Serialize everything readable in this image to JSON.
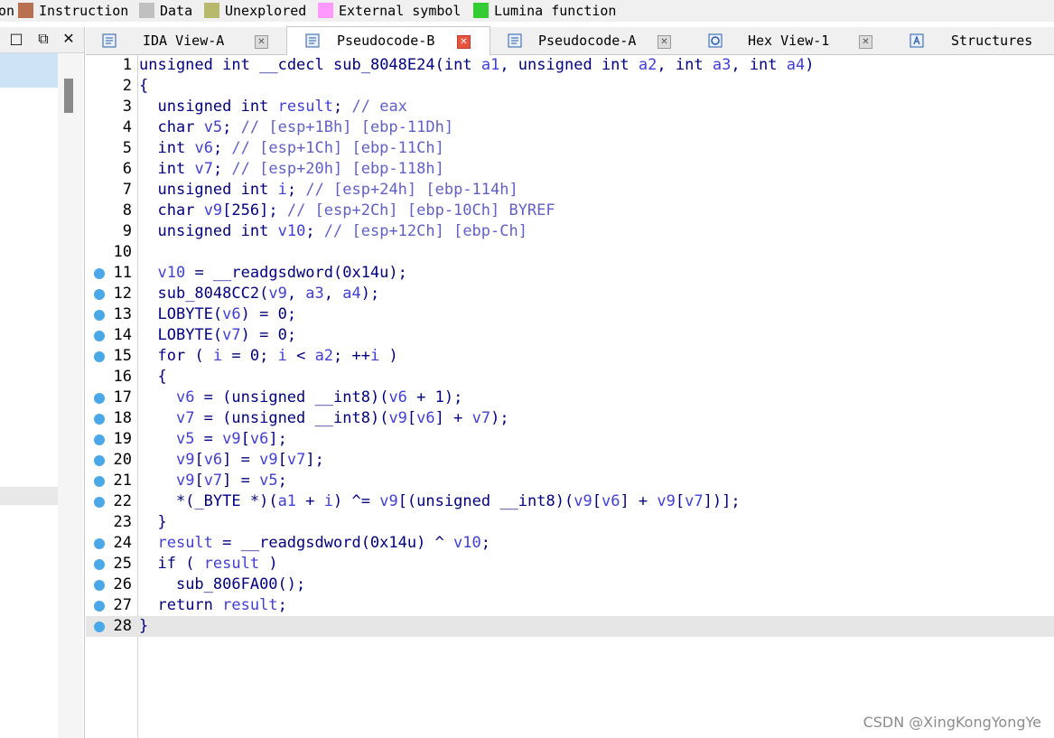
{
  "legend": {
    "items": [
      {
        "label": "on",
        "color": null
      },
      {
        "label": "Instruction",
        "color": "#b97050"
      },
      {
        "label": "Data",
        "color": "#c0c0c0"
      },
      {
        "label": "Unexplored",
        "color": "#b9b96b"
      },
      {
        "label": "External symbol",
        "color": "#ff99ff"
      },
      {
        "label": "Lumina function",
        "color": "#33cc33"
      }
    ]
  },
  "left_panel": {
    "buttons": [
      "□",
      "⧉",
      "✕"
    ]
  },
  "tabs": [
    {
      "label": "IDA View-A",
      "icon": "disassembly-icon",
      "closable": true,
      "active": false
    },
    {
      "label": "Pseudocode-B",
      "icon": "pseudocode-icon",
      "closable": true,
      "active": true
    },
    {
      "label": "Pseudocode-A",
      "icon": "pseudocode-icon",
      "closable": true,
      "active": false
    },
    {
      "label": "Hex View-1",
      "icon": "hex-view-icon",
      "closable": true,
      "active": false
    },
    {
      "label": "Structures",
      "icon": "structures-icon",
      "closable": false,
      "active": false
    }
  ],
  "colors": {
    "keyword": "#000080",
    "variable": "#3f3fd8",
    "comment": "#6060c8",
    "number": "#000080",
    "breakpoint": "#4aa8e8"
  },
  "code": {
    "current_line": 28,
    "lines": [
      {
        "num": "1",
        "bp": false,
        "text": "unsigned int __cdecl sub_8048E24(int a1, unsigned int a2, int a3, int a4)"
      },
      {
        "num": "2",
        "bp": false,
        "text": "{"
      },
      {
        "num": "3",
        "bp": false,
        "text": "  unsigned int result; // eax"
      },
      {
        "num": "4",
        "bp": false,
        "text": "  char v5; // [esp+1Bh] [ebp-11Dh]"
      },
      {
        "num": "5",
        "bp": false,
        "text": "  int v6; // [esp+1Ch] [ebp-11Ch]"
      },
      {
        "num": "6",
        "bp": false,
        "text": "  int v7; // [esp+20h] [ebp-118h]"
      },
      {
        "num": "7",
        "bp": false,
        "text": "  unsigned int i; // [esp+24h] [ebp-114h]"
      },
      {
        "num": "8",
        "bp": false,
        "text": "  char v9[256]; // [esp+2Ch] [ebp-10Ch] BYREF"
      },
      {
        "num": "9",
        "bp": false,
        "text": "  unsigned int v10; // [esp+12Ch] [ebp-Ch]"
      },
      {
        "num": "10",
        "bp": false,
        "text": ""
      },
      {
        "num": "11",
        "bp": true,
        "text": "  v10 = __readgsdword(0x14u);"
      },
      {
        "num": "12",
        "bp": true,
        "text": "  sub_8048CC2(v9, a3, a4);"
      },
      {
        "num": "13",
        "bp": true,
        "text": "  LOBYTE(v6) = 0;"
      },
      {
        "num": "14",
        "bp": true,
        "text": "  LOBYTE(v7) = 0;"
      },
      {
        "num": "15",
        "bp": true,
        "text": "  for ( i = 0; i < a2; ++i )"
      },
      {
        "num": "16",
        "bp": false,
        "text": "  {"
      },
      {
        "num": "17",
        "bp": true,
        "text": "    v6 = (unsigned __int8)(v6 + 1);"
      },
      {
        "num": "18",
        "bp": true,
        "text": "    v7 = (unsigned __int8)(v9[v6] + v7);"
      },
      {
        "num": "19",
        "bp": true,
        "text": "    v5 = v9[v6];"
      },
      {
        "num": "20",
        "bp": true,
        "text": "    v9[v6] = v9[v7];"
      },
      {
        "num": "21",
        "bp": true,
        "text": "    v9[v7] = v5;"
      },
      {
        "num": "22",
        "bp": true,
        "text": "    *(_BYTE *)(a1 + i) ^= v9[(unsigned __int8)(v9[v6] + v9[v7])];"
      },
      {
        "num": "23",
        "bp": false,
        "text": "  }"
      },
      {
        "num": "24",
        "bp": true,
        "text": "  result = __readgsdword(0x14u) ^ v10;"
      },
      {
        "num": "25",
        "bp": true,
        "text": "  if ( result )"
      },
      {
        "num": "26",
        "bp": true,
        "text": "    sub_806FA00();"
      },
      {
        "num": "27",
        "bp": true,
        "text": "  return result;"
      },
      {
        "num": "28",
        "bp": true,
        "text": "}"
      }
    ]
  },
  "watermark": "CSDN @XingKongYongYe"
}
